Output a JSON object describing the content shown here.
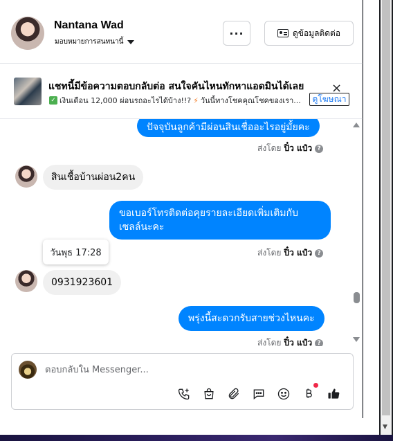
{
  "header": {
    "name": "Nantana Wad",
    "subtitle": "มอบหมายการสนทนานี้",
    "more_label": "···",
    "contact_label": "ดูข้อมูลติดต่อ"
  },
  "ad": {
    "title": "แชทนี้มีข้อความตอบกลับต่อ สนใจคันไหนทักหาแอดมินได้เลย",
    "line": "เงินเดือน 12,000 ผ่อนรถอะไรได้บ้าง!!? ",
    "line2": "วันนี้ทางโชคคุณโชคของเรา...",
    "link_label": "ดูโฆษณา",
    "close_label": "×"
  },
  "messages": {
    "m1": "ปัจจุบันลูกค้ามีผ่อนสินเชื่ออะไรอยู่มั้ยคะ",
    "sent1_prefix": "ส่งโดย",
    "sent1_name": "ปิ๋ว แป๋ว",
    "m2": "สินเชื้อบ้านผ่อน2คน",
    "m3_line1": "ขอเบอร์โทรติดต่อคุยรายละเอียดเพิ่มเติมกับ",
    "m3_line2": "เซลล์นะคะ",
    "sent2_prefix": "ส่งโดย",
    "sent2_name": "ปิ๋ว แป๋ว",
    "tooltip": "วันพุธ 17:28",
    "m4": "0931923601",
    "m5": "พรุ่งนี้สะดวกรับสายช่วงไหนคะ",
    "sent3_prefix": "ส่งโดย",
    "sent3_name": "ปิ๋ว แป๋ว",
    "help_icon": "?"
  },
  "composer": {
    "placeholder": "ตอบกลับใน Messenger..."
  },
  "colors": {
    "outgoing_bubble": "#0084ff",
    "incoming_bubble": "#f0f0f0",
    "accent": "#1877f2"
  }
}
